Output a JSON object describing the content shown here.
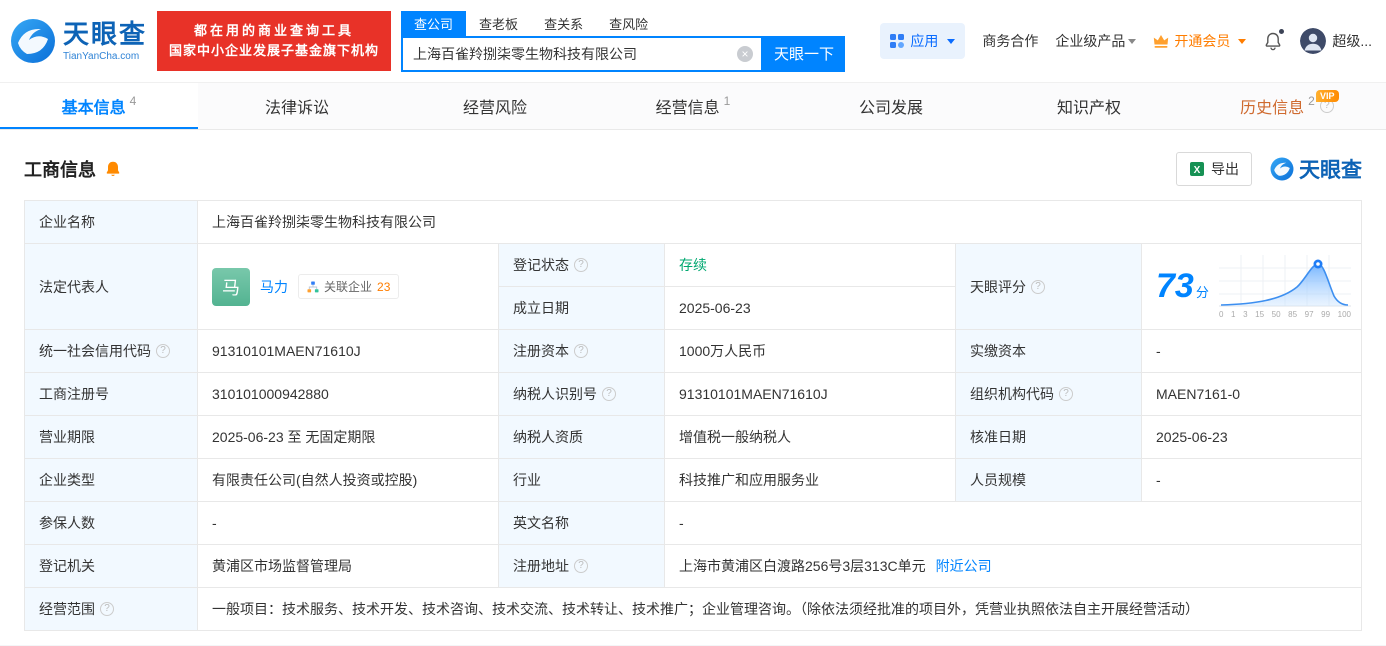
{
  "icons": {
    "help": "?",
    "clear": "×"
  },
  "colors": {
    "brand_blue": "#0084ff",
    "badge_red": "#e83228",
    "vip_orange": "#ff7d00",
    "status_green": "#00a870",
    "label_cell_bg": "#f2f9ff"
  },
  "header": {
    "logo": {
      "brand": "天眼查",
      "domain": "TianYanCha.com"
    },
    "slogan_line1": "都在用的商业查询工具",
    "slogan_line2": "国家中小企业发展子基金旗下机构",
    "search": {
      "tabs": [
        {
          "label": "查公司"
        },
        {
          "label": "查老板"
        },
        {
          "label": "查关系"
        },
        {
          "label": "查风险"
        }
      ],
      "value": "上海百雀羚捌柒零生物科技有限公司",
      "button": "天眼一下"
    },
    "nav": {
      "apps": "应用",
      "cooperation": "商务合作",
      "enterprise_products": "企业级产品",
      "vip": "开通会员",
      "username": "超级..."
    }
  },
  "tabbar": {
    "items": [
      {
        "label": "基本信息",
        "count": "4"
      },
      {
        "label": "法律诉讼",
        "count": ""
      },
      {
        "label": "经营风险",
        "count": ""
      },
      {
        "label": "经营信息",
        "count": "1"
      },
      {
        "label": "公司发展",
        "count": ""
      },
      {
        "label": "知识产权",
        "count": ""
      },
      {
        "label": "历史信息",
        "count": "2",
        "badge": "VIP"
      }
    ]
  },
  "section": {
    "title": "工商信息",
    "export_label": "导出",
    "watermark_brand": "天眼查"
  },
  "table": {
    "company_name": {
      "label": "企业名称",
      "value": "上海百雀羚捌柒零生物科技有限公司"
    },
    "legal_rep": {
      "label": "法定代表人",
      "avatar": "马",
      "name": "马力",
      "related_label": "关联企业",
      "related_count": "23"
    },
    "reg_status": {
      "label": "登记状态",
      "value": "存续"
    },
    "establish_date": {
      "label": "成立日期",
      "value": "2025-06-23"
    },
    "score": {
      "label": "天眼评分",
      "value": "73",
      "unit": "分",
      "axis": [
        "0",
        "1",
        "3",
        "15",
        "50",
        "85",
        "97",
        "99",
        "100"
      ]
    },
    "credit_code": {
      "label": "统一社会信用代码",
      "value": "91310101MAEN71610J"
    },
    "reg_capital": {
      "label": "注册资本",
      "value": "1000万人民币"
    },
    "paid_capital": {
      "label": "实缴资本",
      "value": "-"
    },
    "reg_no": {
      "label": "工商注册号",
      "value": "310101000942880"
    },
    "taxpayer_no": {
      "label": "纳税人识别号",
      "value": "91310101MAEN71610J"
    },
    "org_code": {
      "label": "组织机构代码",
      "value": "MAEN7161-0"
    },
    "term": {
      "label": "营业期限",
      "value": "2025-06-23 至 无固定期限"
    },
    "taxpayer_quality": {
      "label": "纳税人资质",
      "value": "增值税一般纳税人"
    },
    "approve_date": {
      "label": "核准日期",
      "value": "2025-06-23"
    },
    "company_type": {
      "label": "企业类型",
      "value": "有限责任公司(自然人投资或控股)"
    },
    "industry": {
      "label": "行业",
      "value": "科技推广和应用服务业"
    },
    "staff_size": {
      "label": "人员规模",
      "value": "-"
    },
    "insured_num": {
      "label": "参保人数",
      "value": "-"
    },
    "english_name": {
      "label": "英文名称",
      "value": "-"
    },
    "reg_authority": {
      "label": "登记机关",
      "value": "黄浦区市场监督管理局"
    },
    "address": {
      "label": "注册地址",
      "value": "上海市黄浦区白渡路256号3层313C单元",
      "nearby_link": "附近公司"
    },
    "scope": {
      "label": "经营范围",
      "value": "一般项目：技术服务、技术开发、技术咨询、技术交流、技术转让、技术推广；企业管理咨询。（除依法须经批准的项目外，凭营业执照依法自主开展经营活动）"
    }
  }
}
